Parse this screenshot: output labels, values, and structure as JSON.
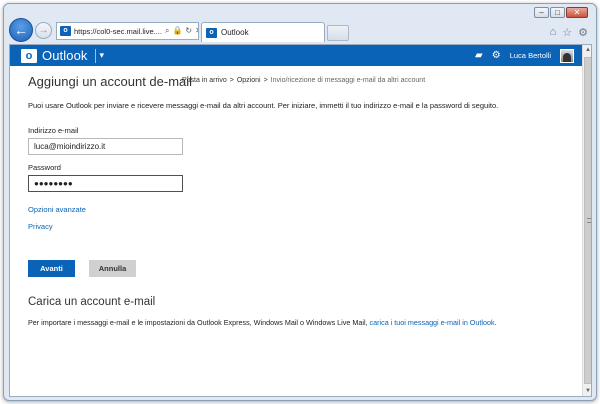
{
  "browser": {
    "address": "https://col0-sec.mail.live....",
    "tab_title": "Outlook",
    "window_controls": [
      "minimize",
      "maximize",
      "close"
    ],
    "tool_icons": [
      "home-icon",
      "star-icon",
      "gear-icon"
    ]
  },
  "header": {
    "logo_letter": "o",
    "app_name": "Outlook",
    "user_name": "Luca Bertolli",
    "colors": {
      "brand": "#0a63b6"
    }
  },
  "page": {
    "title": "Aggiungi un account de-mail",
    "breadcrumb": [
      "Posta in arrivo",
      "Opzioni",
      "Invio/ricezione di messaggi e-mail da altri account"
    ],
    "breadcrumb_sep": ">",
    "intro": "Puoi usare Outlook per inviare e ricevere messaggi e-mail da altri account. Per iniziare, immetti il tuo indirizzo e-mail e la password di seguito."
  },
  "form": {
    "email_label": "Indirizzo e-mail",
    "email_value": "luca@mioindirizzo.it",
    "password_label": "Password",
    "password_value": "●●●●●●●●",
    "advanced_link": "Opzioni avanzate",
    "privacy_link": "Privacy",
    "next_button": "Avanti",
    "cancel_button": "Annulla"
  },
  "import": {
    "title": "Carica un account e-mail",
    "text": "Per importare i messaggi e-mail e le impostazioni da Outlook Express, Windows Mail o Windows Live Mail,",
    "link": "carica i tuoi messaggi e-mail in Outlook",
    "end": "."
  }
}
